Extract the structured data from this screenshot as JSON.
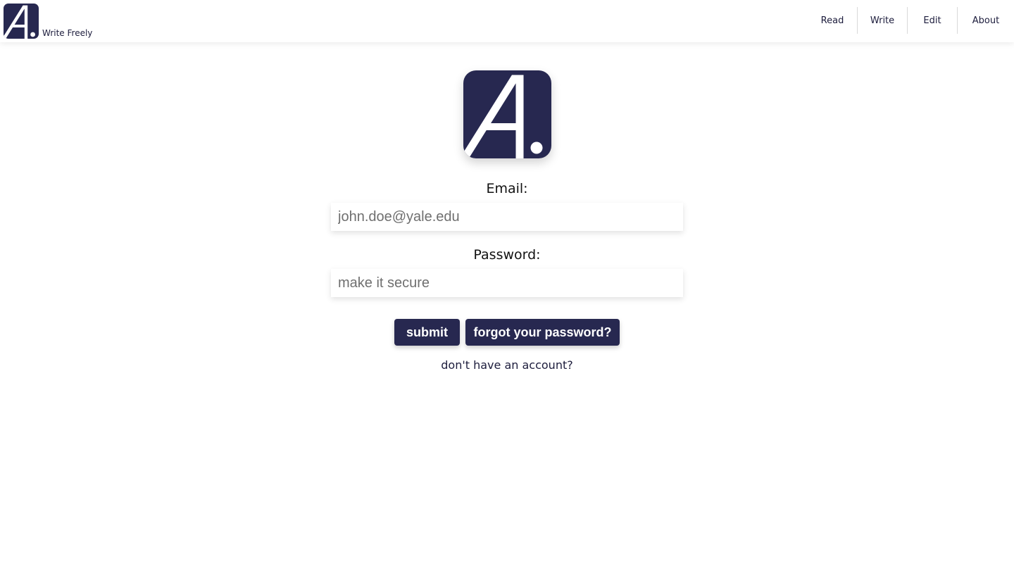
{
  "header": {
    "brand_name": "Write Freely",
    "logo_icon": "letter-a-logo-icon",
    "nav": [
      {
        "label": "Read"
      },
      {
        "label": "Write"
      },
      {
        "label": "Edit"
      },
      {
        "label": "About"
      }
    ]
  },
  "login": {
    "logo_icon": "letter-a-logo-icon",
    "email_label": "Email:",
    "email_placeholder": "john.doe@yale.edu",
    "password_label": "Password:",
    "password_placeholder": "make it secure",
    "submit_label": "submit",
    "forgot_label": "forgot your password?",
    "signup_link": "don't have an account?"
  },
  "colors": {
    "brand": "#272850",
    "background": "#ffffff",
    "text": "#1c1c3c",
    "placeholder": "#6f6f6f"
  }
}
